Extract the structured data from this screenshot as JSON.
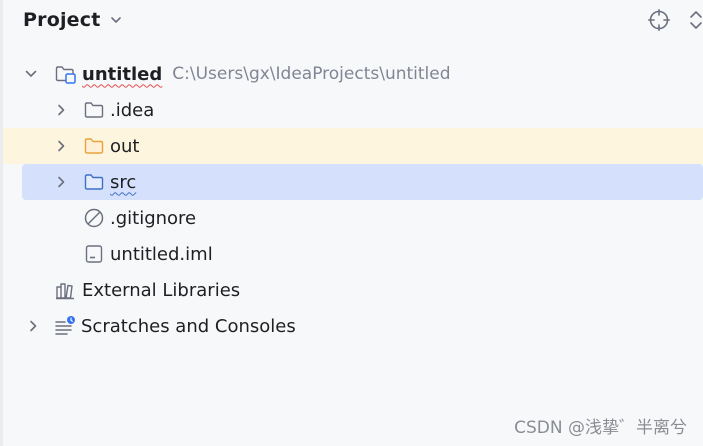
{
  "header": {
    "title": "Project",
    "icons": [
      "chevron-down-icon",
      "locate-target-icon",
      "expand-collapse-icon"
    ]
  },
  "tree": {
    "root": {
      "label": "untitled",
      "path": "C:\\Users\\gx\\IdeaProjects\\untitled",
      "expanded": true
    },
    "children": [
      {
        "label": ".idea",
        "kind": "folder",
        "expanded": false
      },
      {
        "label": "out",
        "kind": "excluded-folder",
        "expanded": false,
        "state": "hover"
      },
      {
        "label": "src",
        "kind": "source-folder",
        "expanded": false,
        "state": "selected"
      },
      {
        "label": ".gitignore",
        "kind": "ignore-file"
      },
      {
        "label": "untitled.iml",
        "kind": "module-file"
      }
    ],
    "external_libraries": {
      "label": "External Libraries"
    },
    "scratches": {
      "label": "Scratches and Consoles",
      "expanded": false
    }
  },
  "colors": {
    "hover_row": "#fdf5dd",
    "selected_row": "#d5e1fc",
    "excluded_folder": "#e8a33d",
    "source_folder": "#3f70c8"
  },
  "watermark": "CSDN @浅挚゛半离兮"
}
